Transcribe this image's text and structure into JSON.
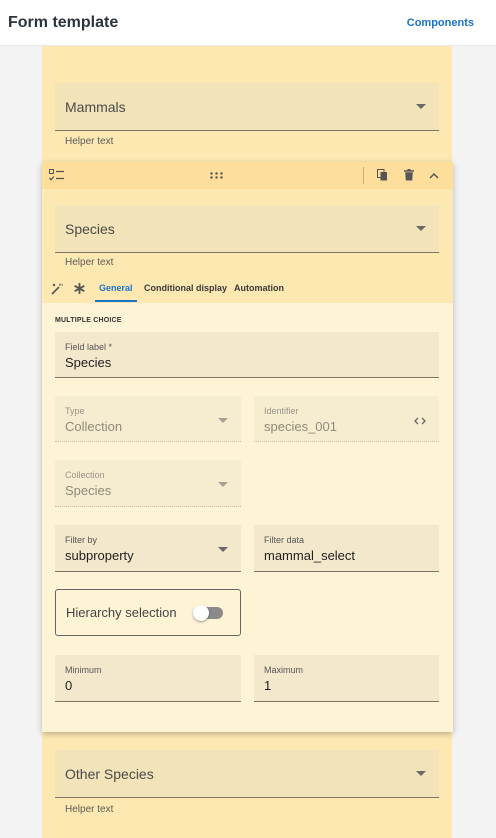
{
  "topbar": {
    "title": "Form template",
    "link": "Components"
  },
  "fields_above": {
    "label": "Mammals",
    "helper": "Helper text"
  },
  "card": {
    "upper": {
      "label": "Species",
      "helper": "Helper text"
    },
    "tabs": [
      {
        "label": "General",
        "active": true
      },
      {
        "label": "Conditional display",
        "active": false
      },
      {
        "label": "Automation",
        "active": false
      }
    ],
    "section_label": "MULTIPLE CHOICE",
    "field_label": {
      "label": "Field label *",
      "value": "Species"
    },
    "type": {
      "label": "Type",
      "value": "Collection"
    },
    "identifier": {
      "label": "Identifier",
      "value": "species_001"
    },
    "collection": {
      "label": "Collection",
      "value": "Species"
    },
    "filter_by": {
      "label": "Filter by",
      "value": "subproperty"
    },
    "filter_data": {
      "label": "Filter data",
      "value": "mammal_select"
    },
    "hierarchy": {
      "label": "Hierarchy selection",
      "enabled": false
    },
    "minimum": {
      "label": "Minimum",
      "value": "0"
    },
    "maximum": {
      "label": "Maximum",
      "value": "1"
    }
  },
  "fields_below": {
    "label": "Other Species",
    "helper": "Helper text"
  },
  "icons": {
    "header_left": "checklist-icon",
    "drag": "drag-handle-icon",
    "copy": "copy-icon",
    "delete": "delete-icon",
    "collapse": "chevron-up-icon",
    "wand": "magic-wand-icon",
    "asterisk": "asterisk-icon",
    "code": "code-icon"
  },
  "colors": {
    "accent": "#1a73c8",
    "card_bg": "#fff3d6",
    "header_bg": "#fddf9b",
    "column_bg": "#fde8b2"
  }
}
